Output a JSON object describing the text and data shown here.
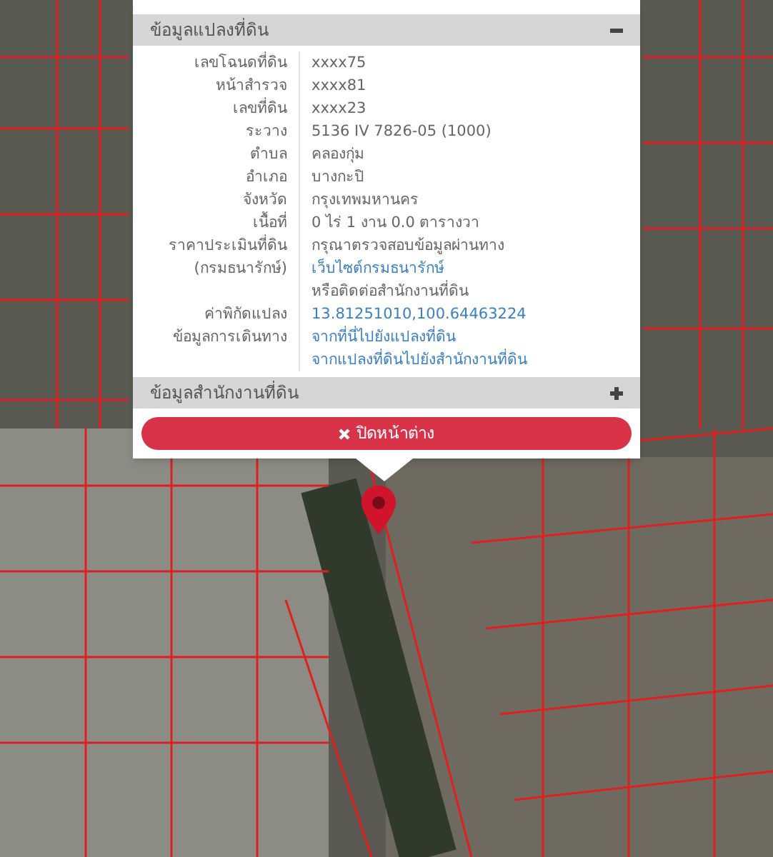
{
  "popup": {
    "sections": [
      {
        "title": "ข้อมูลแปลงที่ดิน",
        "expanded": true,
        "rows": [
          {
            "label": [
              "เลขโฉนดที่ดิน"
            ],
            "value": [
              [
                {
                  "kind": "text",
                  "text": "xxxx75"
                }
              ]
            ]
          },
          {
            "label": [
              "หน้าสำรวจ"
            ],
            "value": [
              [
                {
                  "kind": "text",
                  "text": "xxxx81"
                }
              ]
            ]
          },
          {
            "label": [
              "เลขที่ดิน"
            ],
            "value": [
              [
                {
                  "kind": "text",
                  "text": "xxxx23"
                }
              ]
            ]
          },
          {
            "label": [
              "ระวาง"
            ],
            "value": [
              [
                {
                  "kind": "text",
                  "text": "5136 IV 7826-05 (1000)"
                }
              ]
            ]
          },
          {
            "label": [
              "ตำบล"
            ],
            "value": [
              [
                {
                  "kind": "text",
                  "text": "คลองกุ่ม"
                }
              ]
            ]
          },
          {
            "label": [
              "อำเภอ"
            ],
            "value": [
              [
                {
                  "kind": "text",
                  "text": "บางกะปิ"
                }
              ]
            ]
          },
          {
            "label": [
              "จังหวัด"
            ],
            "value": [
              [
                {
                  "kind": "text",
                  "text": "กรุงเทพมหานคร"
                }
              ]
            ]
          },
          {
            "label": [
              "เนื้อที่"
            ],
            "value": [
              [
                {
                  "kind": "text",
                  "text": "0 ไร่ 1 งาน 0.0 ตารางวา"
                }
              ]
            ]
          },
          {
            "label": [
              "ราคาประเมินที่ดิน",
              "(กรมธนารักษ์)"
            ],
            "value": [
              [
                {
                  "kind": "text",
                  "text": "กรุณาตรวจสอบข้อมูลผ่านทาง "
                },
                {
                  "kind": "link",
                  "text": "เว็บไซต์กรมธนารักษ์"
                }
              ],
              [
                {
                  "kind": "text",
                  "text": "หรือติดต่อสำนักงานที่ดิน"
                }
              ]
            ]
          },
          {
            "label": [
              "ค่าพิกัดแปลง"
            ],
            "value": [
              [
                {
                  "kind": "link",
                  "text": "13.81251010,100.64463224"
                }
              ]
            ]
          },
          {
            "label": [
              "ข้อมูลการเดินทาง"
            ],
            "value": [
              [
                {
                  "kind": "link",
                  "text": "จากที่นี่ไปยังแปลงที่ดิน"
                }
              ],
              [
                {
                  "kind": "link",
                  "text": "จากแปลงที่ดินไปยังสำนักงานที่ดิน"
                }
              ]
            ]
          }
        ]
      },
      {
        "title": "ข้อมูลสำนักงานที่ดิน",
        "expanded": false
      }
    ],
    "close_button": "ปิดหน้าต่าง"
  }
}
